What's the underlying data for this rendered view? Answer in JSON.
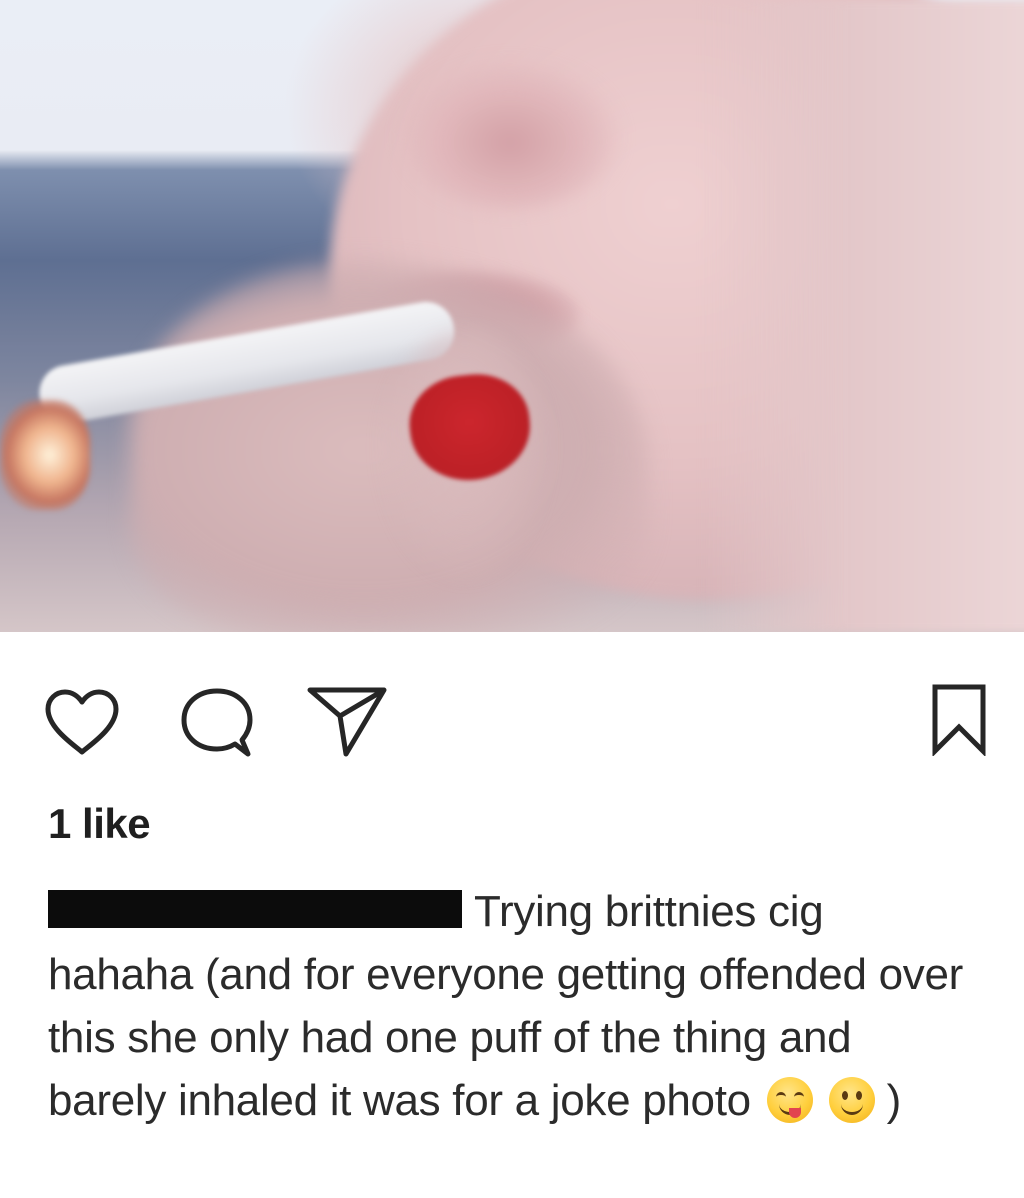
{
  "post": {
    "photo_alt": "",
    "likes_text": "1 like",
    "caption": {
      "text_part_1": "Trying brittnies cig hahaha (and for everyone getting offended over this she only had one puff of the thing and barely inhaled it was for a joke photo",
      "text_part_2": ")"
    }
  },
  "icons": {
    "like": "heart-icon",
    "comment": "comment-bubble-icon",
    "share": "paper-plane-icon",
    "save": "bookmark-icon",
    "emoji_1": "yum-face-emoji",
    "emoji_2": "slight-smile-emoji"
  },
  "colors": {
    "icon_stroke": "#262626",
    "text": "#262626",
    "nail_polish": "#c51f26",
    "redaction": "#0c0c0c"
  }
}
